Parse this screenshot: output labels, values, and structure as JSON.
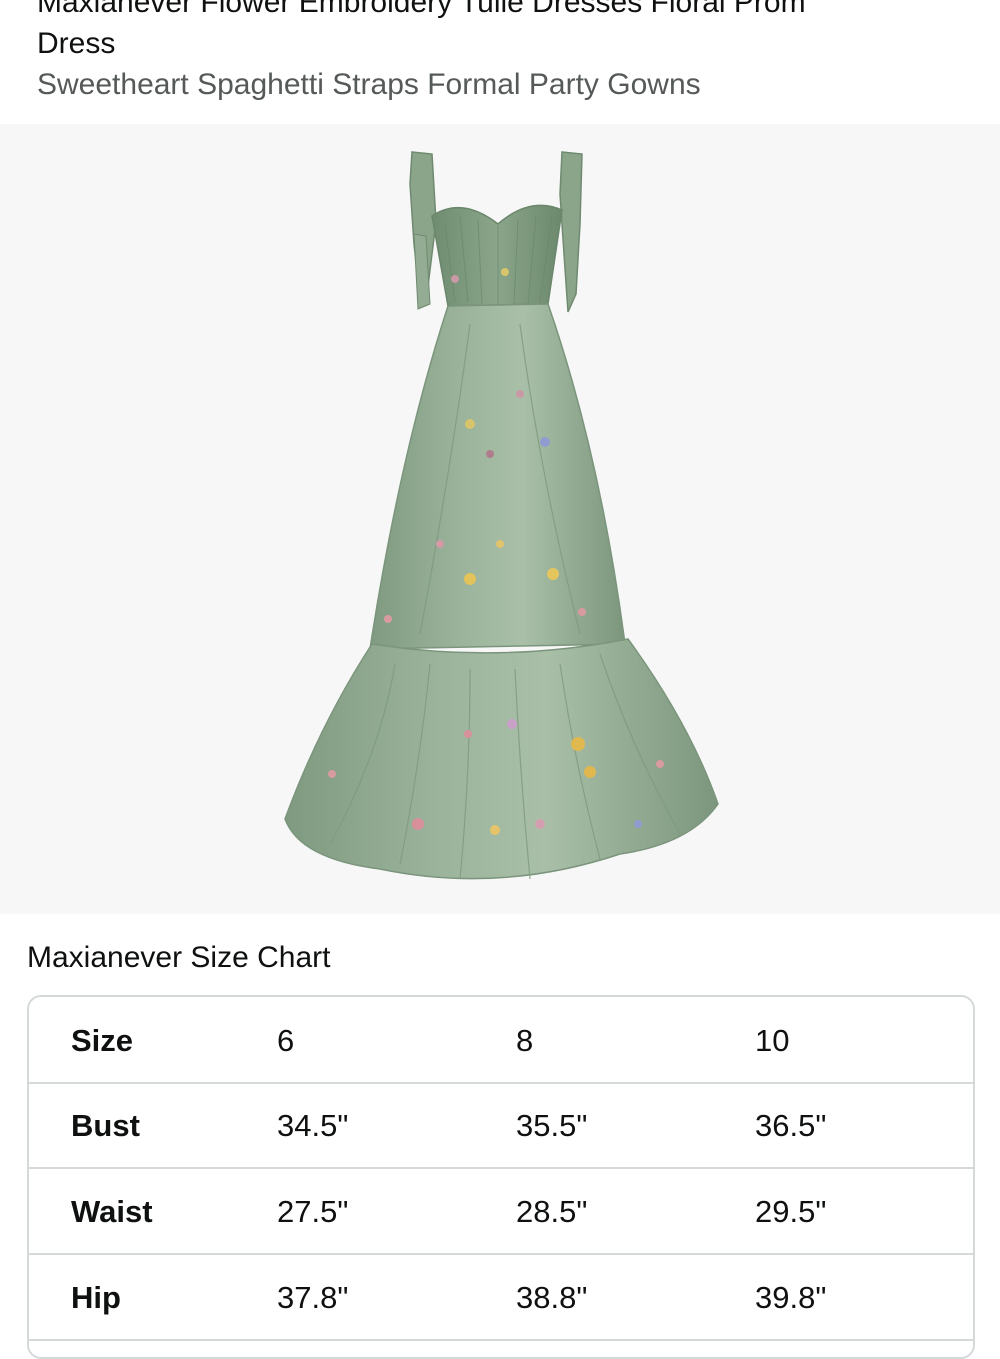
{
  "product": {
    "title": "Maxianever Flower Embroidery Tulle Dresses Floral Prom Dress",
    "title_line_1": "Maxianever Flower Embroidery Tulle Dresses Floral Prom",
    "title_line_2": "Dress",
    "subtitle": "Sweetheart Spaghetti Straps Formal Party Gowns"
  },
  "image": {
    "icon": "dress-photo",
    "dress_color": "#8fa88f",
    "background_color": "#f7f7f7"
  },
  "size_chart": {
    "title": "Maxianever Size Chart",
    "rows": [
      {
        "label": "Size",
        "values": [
          "6",
          "8",
          "10"
        ]
      },
      {
        "label": "Bust",
        "values": [
          "34.5\"",
          "35.5\"",
          "36.5\""
        ]
      },
      {
        "label": "Waist",
        "values": [
          "27.5\"",
          "28.5\"",
          "29.5\""
        ]
      },
      {
        "label": "Hip",
        "values": [
          "37.8\"",
          "38.8\"",
          "39.8\""
        ]
      }
    ]
  }
}
